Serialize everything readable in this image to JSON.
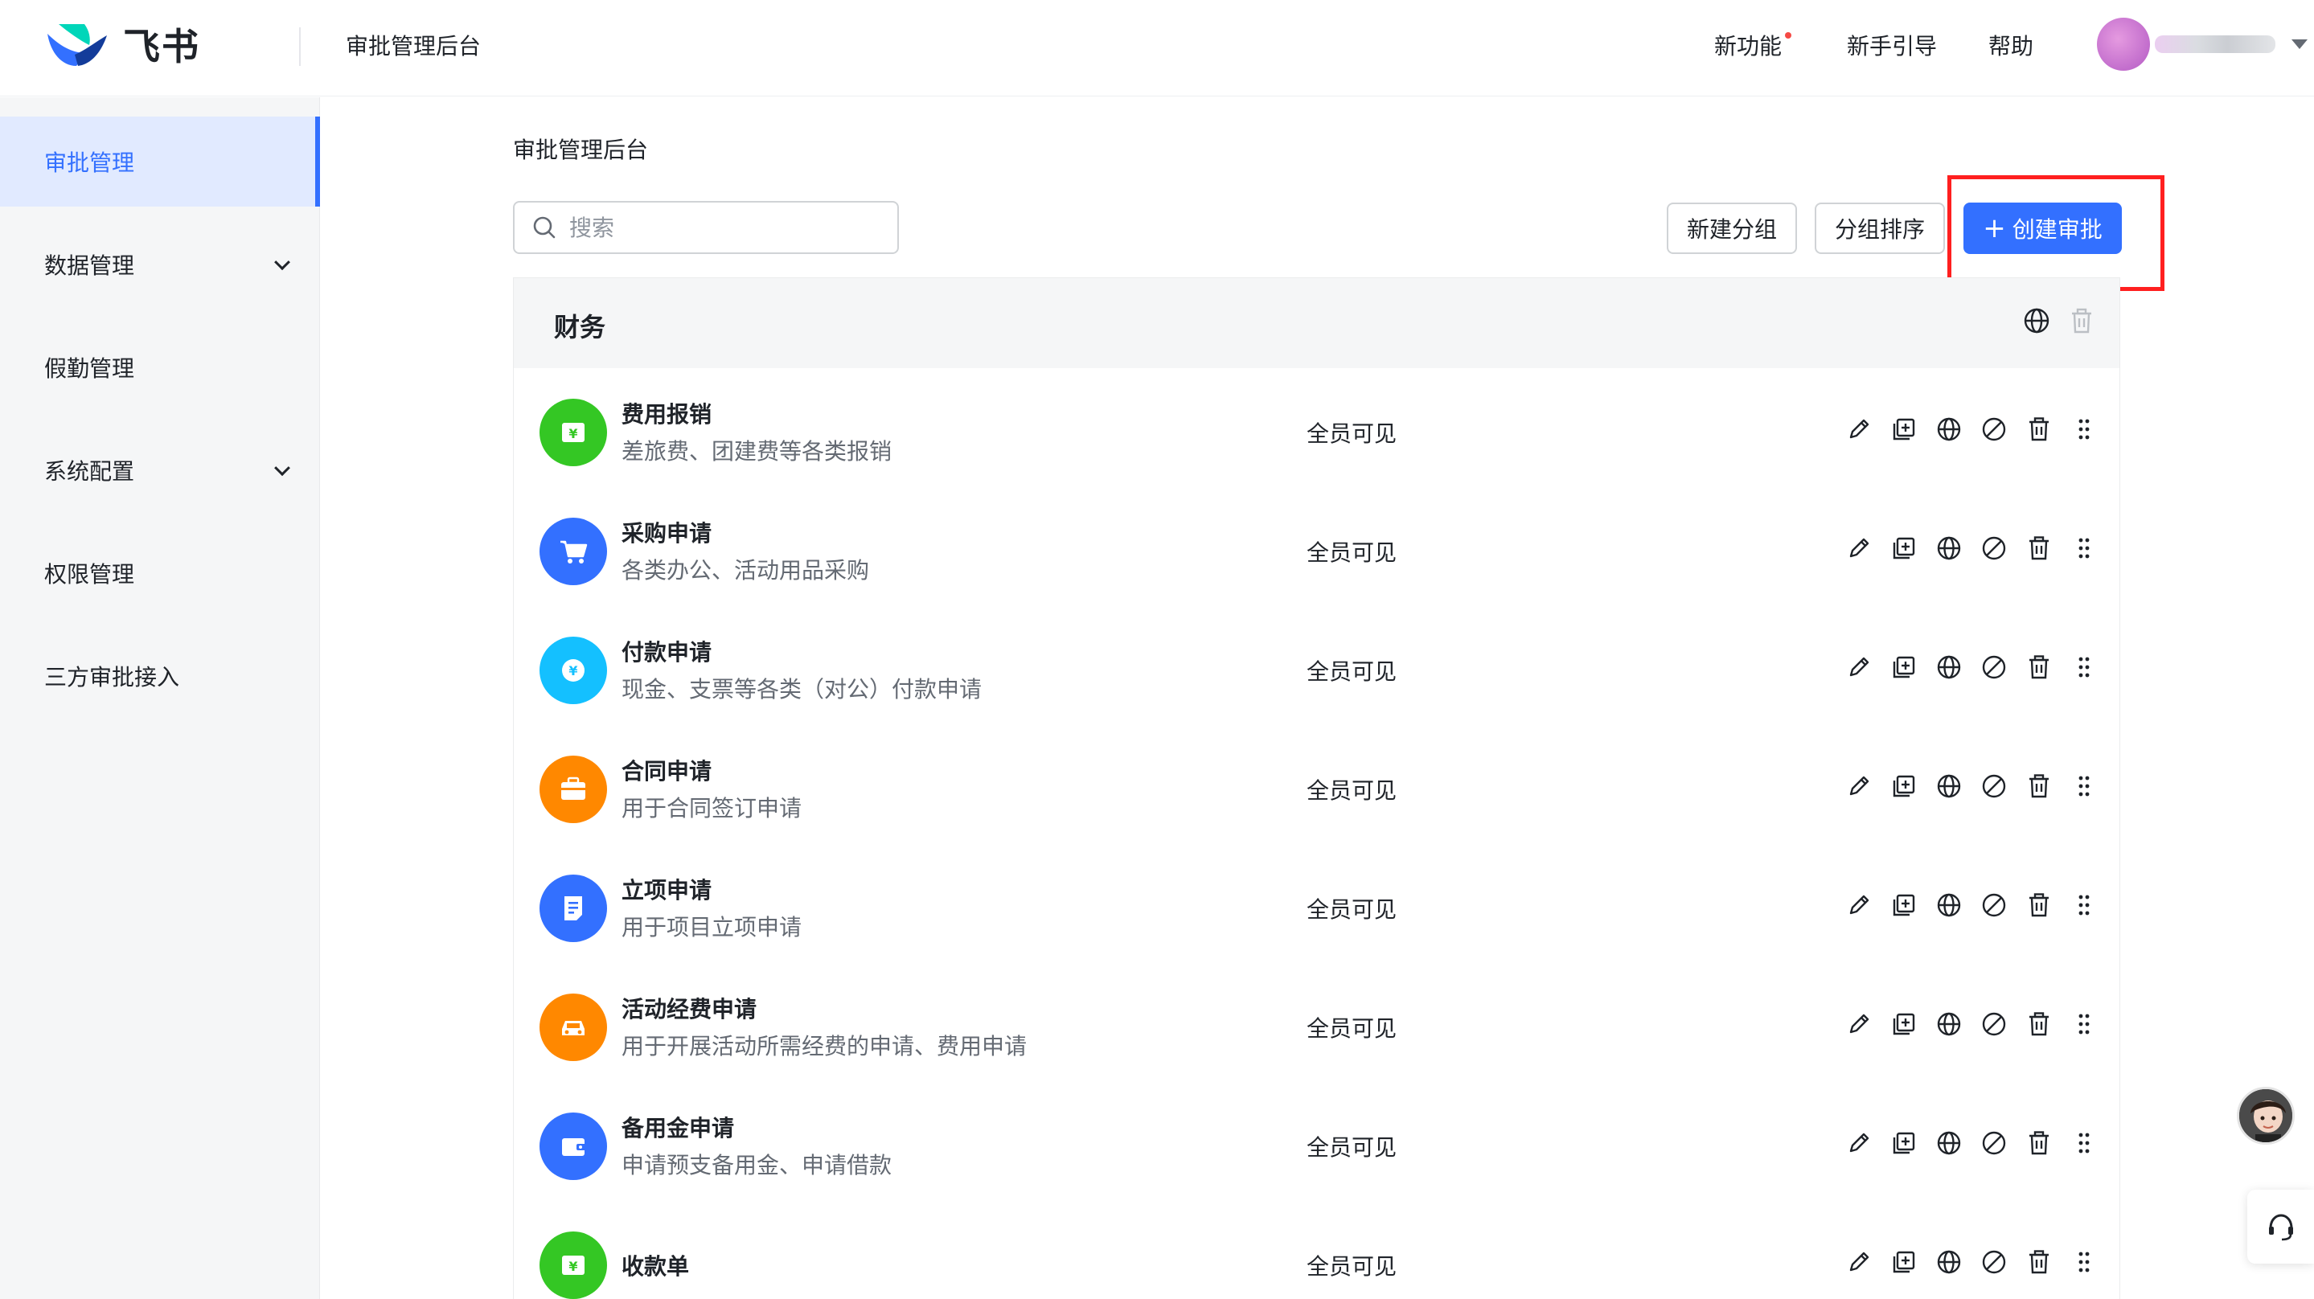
{
  "header": {
    "logo_text": "飞书",
    "app_title": "审批管理后台",
    "nav": {
      "new_features": "新功能",
      "guide": "新手引导",
      "help": "帮助"
    },
    "colors": {
      "brand_blue": "#3370ff",
      "brand_teal": "#00d6b9",
      "red_dot": "#f54a45"
    }
  },
  "sidebar": {
    "items": [
      {
        "label": "审批管理",
        "active": true,
        "has_submenu": false
      },
      {
        "label": "数据管理",
        "active": false,
        "has_submenu": true
      },
      {
        "label": "假勤管理",
        "active": false,
        "has_submenu": false
      },
      {
        "label": "系统配置",
        "active": false,
        "has_submenu": true
      },
      {
        "label": "权限管理",
        "active": false,
        "has_submenu": false
      },
      {
        "label": "三方审批接入",
        "active": false,
        "has_submenu": false
      }
    ]
  },
  "main": {
    "breadcrumb": "审批管理后台",
    "search": {
      "placeholder": "搜索",
      "value": ""
    },
    "toolbar": {
      "new_group": "新建分组",
      "sort_groups": "分组排序",
      "create_approval": "创建审批"
    },
    "group": {
      "title": "财务",
      "rows": [
        {
          "name": "费用报销",
          "desc": "差旅费、团建费等各类报销",
          "visibility": "全员可见",
          "icon": "yen-doc-icon",
          "color": "#34c724"
        },
        {
          "name": "采购申请",
          "desc": "各类办公、活动用品采购",
          "visibility": "全员可见",
          "icon": "cart-icon",
          "color": "#3370ff"
        },
        {
          "name": "付款申请",
          "desc": "现金、支票等各类（对公）付款申请",
          "visibility": "全员可见",
          "icon": "yen-coin-icon",
          "color": "#14c0ff"
        },
        {
          "name": "合同申请",
          "desc": "用于合同签订申请",
          "visibility": "全员可见",
          "icon": "briefcase-icon",
          "color": "#ff8800"
        },
        {
          "name": "立项申请",
          "desc": "用于项目立项申请",
          "visibility": "全员可见",
          "icon": "document-icon",
          "color": "#3370ff"
        },
        {
          "name": "活动经费申请",
          "desc": "用于开展活动所需经费的申请、费用申请",
          "visibility": "全员可见",
          "icon": "car-icon",
          "color": "#ff8800"
        },
        {
          "name": "备用金申请",
          "desc": "申请预支备用金、申请借款",
          "visibility": "全员可见",
          "icon": "wallet-icon",
          "color": "#3370ff"
        },
        {
          "name": "收款单",
          "desc": "",
          "visibility": "全员可见",
          "icon": "yen-doc-icon",
          "color": "#34c724"
        }
      ]
    }
  }
}
